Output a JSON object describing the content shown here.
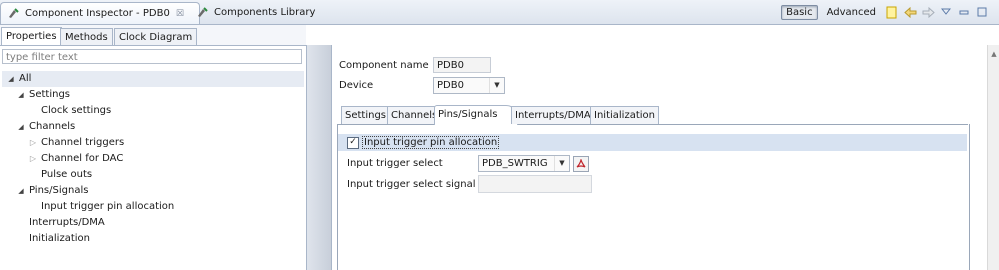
{
  "views": {
    "inspector_tab": "Component Inspector - PDB0",
    "library_tab": "Components Library",
    "close_glyph": "☒",
    "mode_basic": "Basic",
    "mode_advanced": "Advanced"
  },
  "left": {
    "tabs": [
      "Properties",
      "Methods",
      "Clock Diagram"
    ],
    "filter_placeholder": "type filter text",
    "tree": [
      {
        "label": "All",
        "level": 0,
        "toggle": "expanded"
      },
      {
        "label": "Settings",
        "level": 1,
        "toggle": "expanded"
      },
      {
        "label": "Clock settings",
        "level": 2,
        "toggle": "none"
      },
      {
        "label": "Channels",
        "level": 1,
        "toggle": "expanded"
      },
      {
        "label": "Channel triggers",
        "level": 2,
        "toggle": "collapsed"
      },
      {
        "label": "Channel for DAC",
        "level": 2,
        "toggle": "collapsed"
      },
      {
        "label": "Pulse outs",
        "level": 2,
        "toggle": "none"
      },
      {
        "label": "Pins/Signals",
        "level": 1,
        "toggle": "expanded"
      },
      {
        "label": "Input trigger pin allocation",
        "level": 2,
        "toggle": "none"
      },
      {
        "label": "Interrupts/DMA",
        "level": 1,
        "toggle": "none"
      },
      {
        "label": "Initialization",
        "level": 1,
        "toggle": "none"
      }
    ]
  },
  "right": {
    "component_name_label": "Component name",
    "component_name_value": "PDB0",
    "device_label": "Device",
    "device_value": "PDB0",
    "tabs": [
      "Settings",
      "Channels",
      "Pins/Signals",
      "Interrupts/DMA",
      "Initialization"
    ],
    "active_tab": "Pins/Signals",
    "group_label": "Input trigger pin allocation",
    "group_checked": true,
    "check_glyph": "✓",
    "trigger_select_label": "Input trigger select",
    "trigger_select_value": "PDB_SWTRIG",
    "trigger_signal_label": "Input trigger select signal",
    "trigger_signal_value": ""
  },
  "colors": {
    "accent": "#d7e2f1",
    "pdf_red": "#c0262d",
    "border": "#a9b6c9"
  }
}
